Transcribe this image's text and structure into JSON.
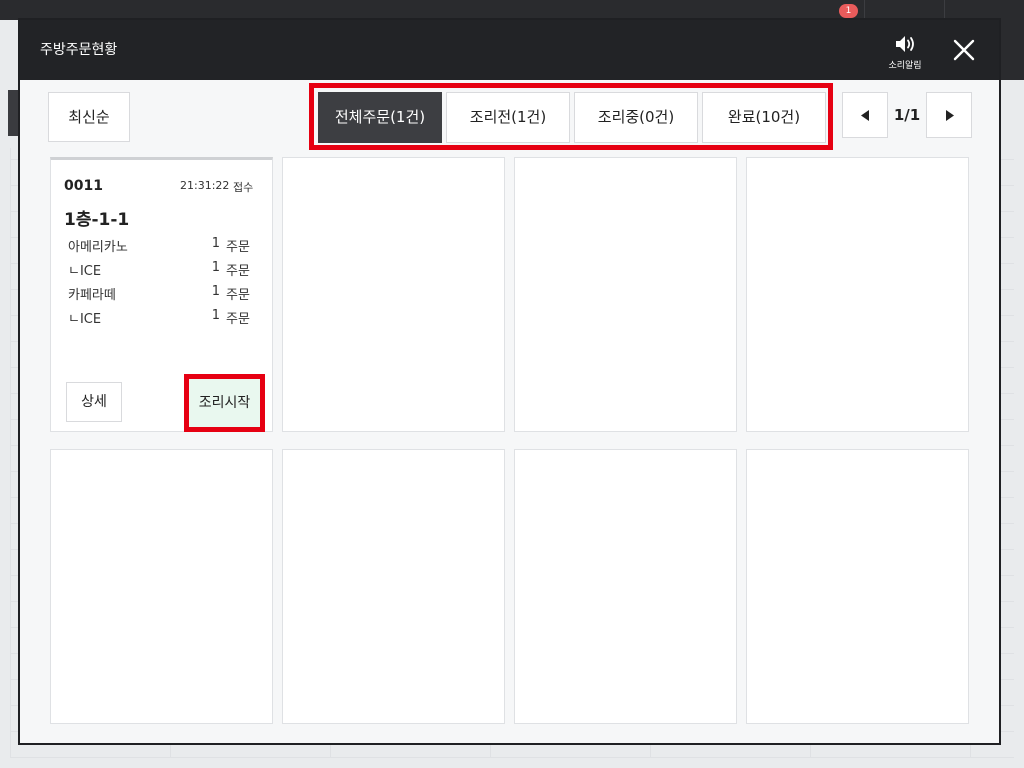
{
  "background": {
    "notification_badge": "1"
  },
  "modal": {
    "title": "주방주문현황",
    "sound": {
      "icon": "speaker-icon",
      "label": "소리알림"
    },
    "close": {
      "icon": "close-icon"
    }
  },
  "toolbar": {
    "sort_label": "최신순",
    "tabs": [
      {
        "label": "전체주문(1건)",
        "active": true
      },
      {
        "label": "조리전(1건)",
        "active": false
      },
      {
        "label": "조리중(0건)",
        "active": false
      },
      {
        "label": "완료(10건)",
        "active": false
      }
    ],
    "pagination": {
      "prev_icon": "caret-left-icon",
      "next_icon": "caret-right-icon",
      "page": "1/1"
    }
  },
  "orders": [
    {
      "number": "0011",
      "time": "21:31:22",
      "status": "접수",
      "table": "1층-1-1",
      "items": [
        {
          "name": "아메리카노",
          "qty": "1",
          "unit": "주문"
        },
        {
          "name": "ㄴICE",
          "qty": "1",
          "unit": "주문"
        },
        {
          "name": "카페라떼",
          "qty": "1",
          "unit": "주문"
        },
        {
          "name": "ㄴICE",
          "qty": "1",
          "unit": "주문"
        }
      ],
      "detail_label": "상세",
      "cook_label": "조리시작"
    }
  ],
  "colors": {
    "header": "#222326",
    "active_tab": "#3d3e42",
    "highlight": "#e60012",
    "cook_button": "#e9f8ef",
    "badge": "#e95b5b"
  }
}
